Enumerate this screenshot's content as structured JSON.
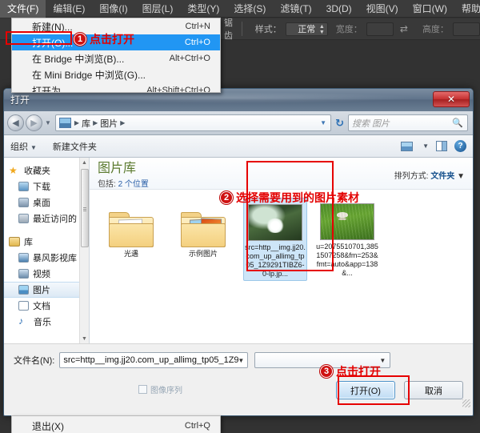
{
  "app": {
    "menubar": [
      {
        "label": "文件(F)",
        "active": true
      },
      {
        "label": "编辑(E)",
        "active": false
      },
      {
        "label": "图像(I)",
        "active": false
      },
      {
        "label": "图层(L)",
        "active": false
      },
      {
        "label": "类型(Y)",
        "active": false
      },
      {
        "label": "选择(S)",
        "active": false
      },
      {
        "label": "滤镜(T)",
        "active": false
      },
      {
        "label": "3D(D)",
        "active": false
      },
      {
        "label": "视图(V)",
        "active": false
      },
      {
        "label": "窗口(W)",
        "active": false
      },
      {
        "label": "帮助(H)",
        "active": false
      }
    ],
    "options_bar": {
      "left_fragment": "锯齿",
      "style_label": "样式：",
      "style_value": "正常",
      "width_label": "宽度：",
      "width_value": "",
      "swap_icon": "swap-arrows-icon",
      "height_label": "高度：",
      "height_value": ""
    }
  },
  "file_menu": {
    "items": [
      {
        "label": "新建(N)...",
        "accel": "Ctrl+N",
        "selected": false
      },
      {
        "label": "打开(O)...",
        "accel": "Ctrl+O",
        "selected": true
      },
      {
        "label": "在 Bridge 中浏览(B)...",
        "accel": "Alt+Ctrl+O",
        "selected": false
      },
      {
        "label": "在 Mini Bridge 中浏览(G)...",
        "accel": "",
        "selected": false
      },
      {
        "label": "打开为",
        "accel": "Alt+Shift+Ctrl+O",
        "selected": false
      }
    ],
    "bottom_items": [
      {
        "label": "退出(X)",
        "accel": "Ctrl+Q",
        "selected": false
      }
    ]
  },
  "annotations": [
    {
      "number": "1",
      "text": "点击打开"
    },
    {
      "number": "2",
      "text": "选择需要用到的图片素材"
    },
    {
      "number": "3",
      "text": "点击打开"
    }
  ],
  "dialog": {
    "title": "打开",
    "close_label": "✕",
    "nav": {
      "back_icon": "back-arrow-icon",
      "forward_icon": "forward-arrow-icon",
      "history_icon": "history-dropdown-icon",
      "breadcrumb": [
        "库",
        "图片"
      ],
      "breadcrumb_caret": "▼",
      "refresh_icon": "refresh-icon",
      "search_placeholder": "搜索 图片",
      "search_icon": "search-icon"
    },
    "toolbar": {
      "organize": "组织",
      "organize_caret": "▼",
      "new_folder": "新建文件夹",
      "view_icon": "view-layout-icon",
      "view_caret": "▼",
      "preview_pane_icon": "preview-pane-icon",
      "help_icon": "help-icon",
      "help_glyph": "?"
    },
    "sidebar": [
      {
        "label": "收藏夹",
        "icon": "star-icon",
        "level": 0,
        "selected": false
      },
      {
        "label": "下载",
        "icon": "downloads-icon",
        "level": 1,
        "selected": false
      },
      {
        "label": "桌面",
        "icon": "desktop-icon",
        "level": 1,
        "selected": false
      },
      {
        "label": "最近访问的",
        "icon": "recent-places-icon",
        "level": 1,
        "selected": false
      },
      {
        "label": "库",
        "icon": "library-icon",
        "level": 0,
        "selected": false
      },
      {
        "label": "暴风影视库",
        "icon": "storm-video-icon",
        "level": 1,
        "selected": false
      },
      {
        "label": "视频",
        "icon": "videos-icon",
        "level": 1,
        "selected": false
      },
      {
        "label": "图片",
        "icon": "pictures-icon",
        "level": 1,
        "selected": true
      },
      {
        "label": "文档",
        "icon": "documents-icon",
        "level": 1,
        "selected": false
      },
      {
        "label": "音乐",
        "icon": "music-icon",
        "level": 1,
        "selected": false
      }
    ],
    "library": {
      "title": "图片库",
      "subtitle_prefix": "包括: ",
      "subtitle_link": "2 个位置",
      "arrange_label": "排列方式:",
      "arrange_value": "文件夹",
      "arrange_caret": "▼"
    },
    "items": [
      {
        "type": "folder",
        "name": "光遇",
        "selected": false,
        "style": "empty"
      },
      {
        "type": "folder",
        "name": "示例图片",
        "selected": false,
        "style": "photos"
      },
      {
        "type": "photo",
        "name": "src=http__img.jj20.com_up_allimg_tp05_1Z9291TIBZ6-0-lp.jp...",
        "selected": true,
        "thumb": "lotus-flower"
      },
      {
        "type": "photo",
        "name": "u=2075510701,3851507258&fm=253&fmt=auto&app=138&...",
        "selected": false,
        "thumb": "mushroom-grass"
      }
    ],
    "footer": {
      "filename_label": "文件名(N):",
      "filename_value": "src=http__img.jj20.com_up_allimg_tp05_1Z9",
      "filename_caret": "▼",
      "filetype_value": "",
      "filetype_caret": "▼",
      "image_sequence_label": "图像序列",
      "image_sequence_checked": false,
      "open_button": "打开(O)",
      "cancel_button": "取消"
    }
  },
  "colors": {
    "accent_red": "#e60000",
    "selection_blue": "#2196f3",
    "library_green": "#5b7a2e",
    "link_blue": "#15508c"
  }
}
